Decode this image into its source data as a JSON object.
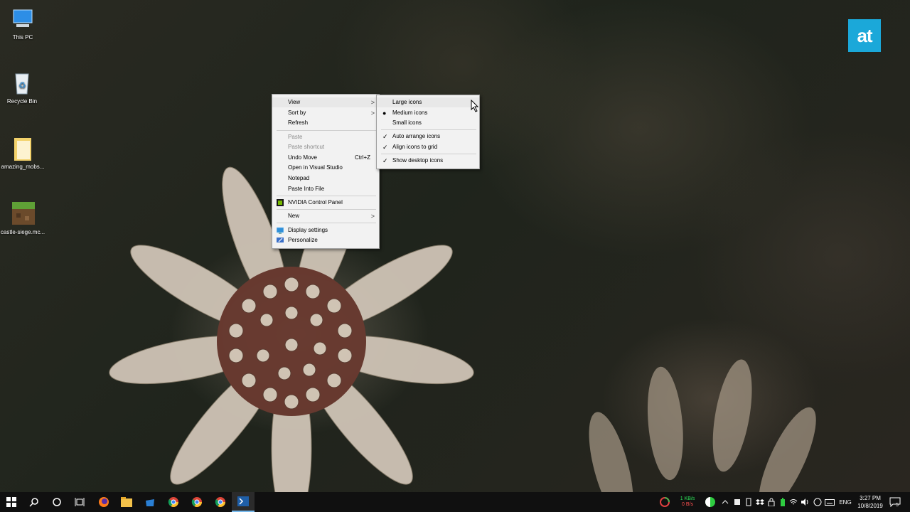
{
  "desktop": {
    "icons": [
      {
        "label": "This PC",
        "icon": "computer-icon"
      },
      {
        "label": "Recycle Bin",
        "icon": "recycle-bin-icon"
      },
      {
        "label": "amazing_mobs...",
        "icon": "folder-icon"
      },
      {
        "label": "castle-siege.mc...",
        "icon": "minecraft-icon"
      }
    ],
    "watermark": "at"
  },
  "context_menu": {
    "items": [
      {
        "label": "View",
        "has_submenu": true
      },
      {
        "label": "Sort by",
        "has_submenu": true
      },
      {
        "label": "Refresh"
      },
      {
        "label": "Paste",
        "disabled": true
      },
      {
        "label": "Paste shortcut",
        "disabled": true
      },
      {
        "label": "Undo Move",
        "shortcut": "Ctrl+Z"
      },
      {
        "label": "Open in Visual Studio"
      },
      {
        "label": "Notepad"
      },
      {
        "label": "Paste Into File"
      },
      {
        "label": "NVIDIA Control Panel",
        "icon": "nvidia-icon"
      },
      {
        "label": "New",
        "has_submenu": true
      },
      {
        "label": "Display settings",
        "icon": "display-icon"
      },
      {
        "label": "Personalize",
        "icon": "personalize-icon"
      }
    ]
  },
  "view_submenu": {
    "items": [
      {
        "label": "Large icons",
        "mark": ""
      },
      {
        "label": "Medium icons",
        "mark": "●"
      },
      {
        "label": "Small icons",
        "mark": ""
      },
      {
        "label": "Auto arrange icons",
        "mark": "✓"
      },
      {
        "label": "Align icons to grid",
        "mark": "✓"
      },
      {
        "label": "Show desktop icons",
        "mark": "✓"
      }
    ]
  },
  "taskbar": {
    "apps": [
      "windows-start-icon",
      "search-icon",
      "cortana-icon",
      "task-view-icon",
      "firefox-icon",
      "file-explorer-icon",
      "store-icon",
      "chrome-icon",
      "chrome-icon",
      "chrome-icon",
      "powershell-icon"
    ],
    "network_up": "1 KB/s",
    "network_down": "0 B/s",
    "language": "ENG",
    "time": "3:27 PM",
    "date": "10/8/2019",
    "notification_count": "5"
  },
  "colors": {
    "taskbar": "#101010",
    "menu_bg": "#f2f2f2",
    "watermark": "#1ba8d9",
    "accent": "#76b9ed"
  }
}
